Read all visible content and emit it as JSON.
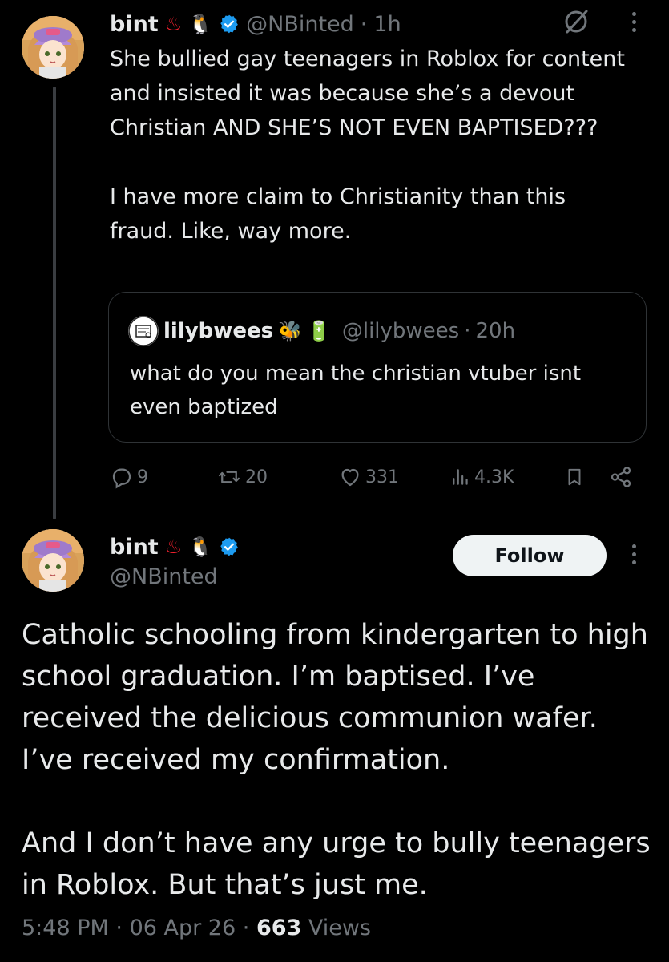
{
  "tweet1": {
    "display_name": "bint",
    "name_emojis": [
      "♨",
      "🐧"
    ],
    "handle": "@NBinted",
    "separator": "·",
    "time_ago": "1h",
    "paragraphs": [
      "She bullied gay teenagers in Roblox for content and insisted it was because she’s a devout Christian AND SHE’S NOT EVEN BAPTISED???",
      "I have more claim to Christianity than this fraud. Like, way more."
    ],
    "quote": {
      "display_name": "lilybwees",
      "name_emojis": [
        "🐝",
        "🔋"
      ],
      "handle": "@lilybwees",
      "separator": "·",
      "time_ago": "20h",
      "text": "what do you mean the christian vtuber isnt even baptized"
    },
    "actions": {
      "replies": "9",
      "reposts": "20",
      "likes": "331",
      "views": "4.3K"
    }
  },
  "tweet2": {
    "display_name": "bint",
    "name_emojis": [
      "♨",
      "🐧"
    ],
    "handle": "@NBinted",
    "follow_label": "Follow",
    "paragraphs": [
      "Catholic schooling from kindergarten to high school graduation. I’m baptised. I’ve received the delicious communion wafer. I’ve received my confirmation.",
      "And I don’t have any urge to bully teenagers in Roblox. But that’s just me."
    ],
    "meta": {
      "time": "5:48 PM",
      "date": "06 Apr 26",
      "views_count": "663",
      "views_label": "Views",
      "separator": "·"
    }
  },
  "colors": {
    "background": "#000000",
    "text": "#e7e9ea",
    "secondary": "#71767b",
    "verified": "#1d9bf0",
    "border": "#2f3336"
  }
}
